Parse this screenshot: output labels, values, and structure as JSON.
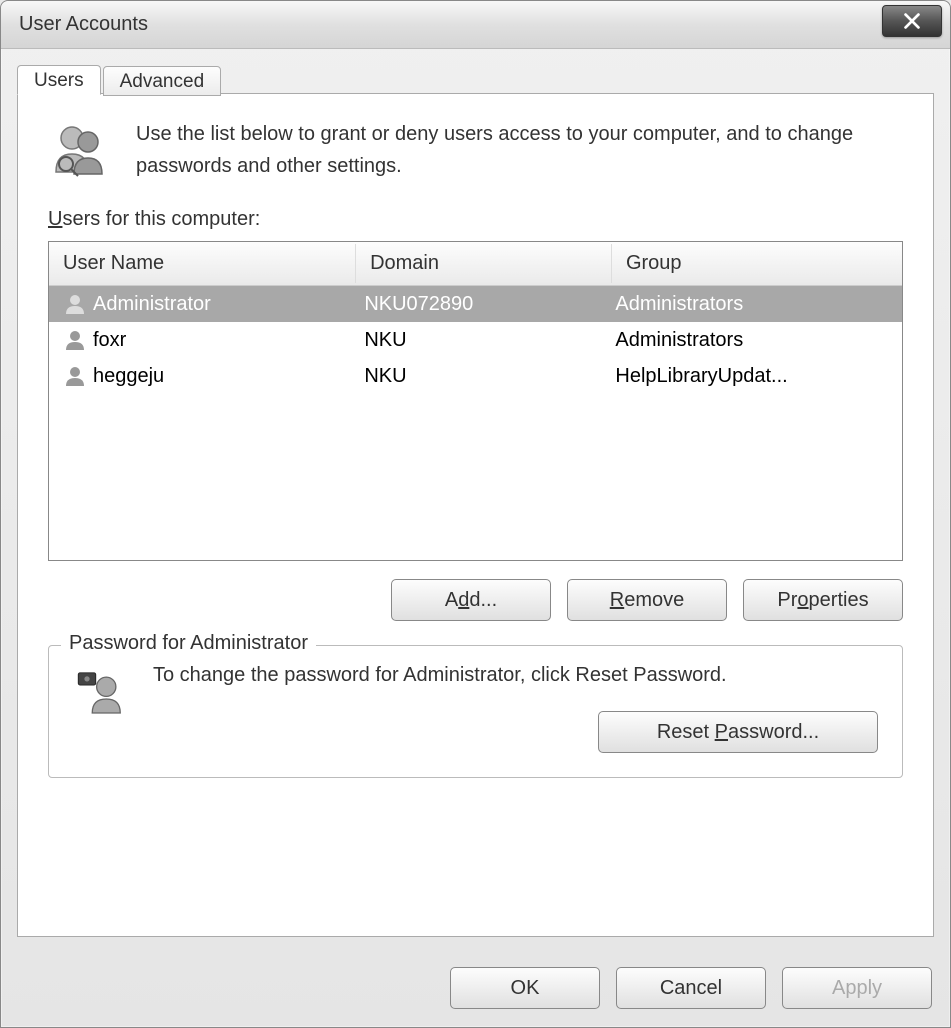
{
  "window": {
    "title": "User Accounts"
  },
  "tabs": {
    "users": "Users",
    "advanced": "Advanced"
  },
  "intro_text": "Use the list below to grant or deny users access to your computer, and to change passwords and other settings.",
  "list_label_prefix": "U",
  "list_label_rest": "sers for this computer:",
  "columns": {
    "user": "User Name",
    "domain": "Domain",
    "group": "Group"
  },
  "users": [
    {
      "name": "Administrator",
      "domain": "NKU072890",
      "group": "Administrators",
      "selected": true
    },
    {
      "name": "foxr",
      "domain": "NKU",
      "group": "Administrators",
      "selected": false
    },
    {
      "name": "heggeju",
      "domain": "NKU",
      "group": "HelpLibraryUpdat...",
      "selected": false
    }
  ],
  "buttons": {
    "add_prefix": "A",
    "add_underline": "d",
    "add_suffix": "d...",
    "remove_prefix": "",
    "remove_underline": "R",
    "remove_suffix": "emove",
    "properties_prefix": "Pr",
    "properties_underline": "o",
    "properties_suffix": "perties"
  },
  "password_section": {
    "legend": "Password for Administrator",
    "text": "To change the password for Administrator, click Reset Password.",
    "reset_prefix": "Reset ",
    "reset_underline": "P",
    "reset_suffix": "assword..."
  },
  "footer": {
    "ok": "OK",
    "cancel": "Cancel",
    "apply": "Apply"
  }
}
